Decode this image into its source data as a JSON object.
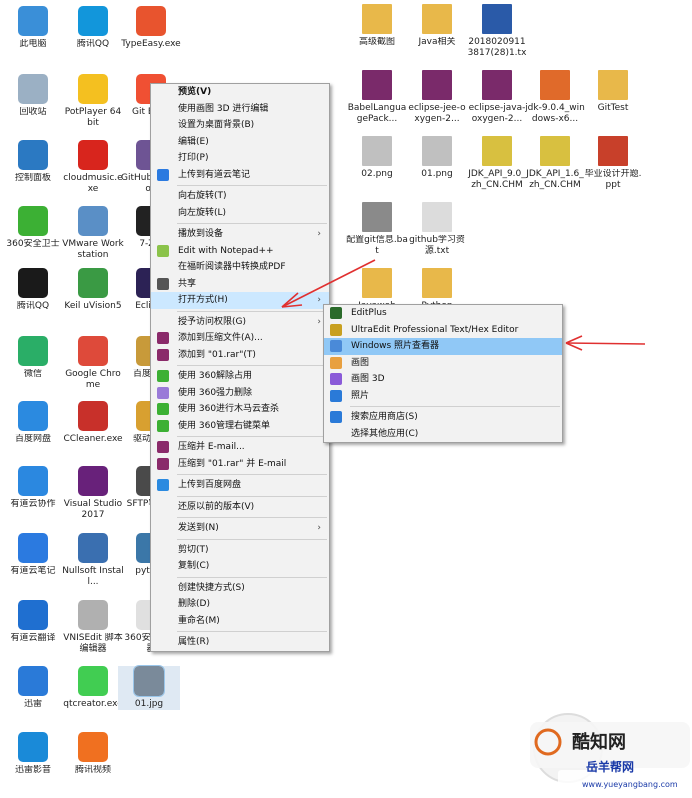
{
  "desktop_icons": [
    {
      "label": "此电脑",
      "color": "#3a8fd8"
    },
    {
      "label": "腾讯QQ",
      "color": "#1296db"
    },
    {
      "label": "TypeEasy.exe",
      "color": "#e8542e"
    },
    {
      "label": "回收站",
      "color": "#9bb0c4"
    },
    {
      "label": "PotPlayer 64 bit",
      "color": "#f4c020"
    },
    {
      "label": "Git Bash",
      "color": "#f05033"
    },
    {
      "label": "控制面板",
      "color": "#2b79c2"
    },
    {
      "label": "cloudmusic.exe",
      "color": "#d8251d"
    },
    {
      "label": "GitHub Desktop",
      "color": "#6e5494"
    },
    {
      "label": "360安全卫士",
      "color": "#3cb034"
    },
    {
      "label": "VMware Workstation",
      "color": "#5a8fc6"
    },
    {
      "label": "7-Zip",
      "color": "#222222"
    },
    {
      "label": "腾讯QQ",
      "color": "#1a1a1a"
    },
    {
      "label": "Keil uVision5",
      "color": "#3a9a44"
    },
    {
      "label": "Eclipse",
      "color": "#2c2255"
    },
    {
      "label": "微信",
      "color": "#2aae67"
    },
    {
      "label": "Google Chrome",
      "color": "#de4a3a"
    },
    {
      "label": "百度网盘",
      "color": "#c89a3a"
    },
    {
      "label": "百度网盘",
      "color": "#2b8ae0"
    },
    {
      "label": "CCleaner.exe",
      "color": "#c8302a"
    },
    {
      "label": "驱动精灵",
      "color": "#d8a030"
    },
    {
      "label": "有道云协作",
      "color": "#2b88e0"
    },
    {
      "label": "Visual Studio 2017",
      "color": "#68217a"
    },
    {
      "label": "SFTP客户端",
      "color": "#4a4a4a"
    },
    {
      "label": "有道云笔记",
      "color": "#2b7ae0"
    },
    {
      "label": "Nullsoft Install...",
      "color": "#3a6fb0"
    },
    {
      "label": "python",
      "color": "#3b77a8"
    },
    {
      "label": "有道云翻译",
      "color": "#1f6fd0"
    },
    {
      "label": "VNISEdit 脚本编辑器",
      "color": "#b0b0b0"
    },
    {
      "label": "360安全浏览器",
      "color": "#e0e0e0"
    },
    {
      "label": "迅雷",
      "color": "#2a7ad8"
    },
    {
      "label": "qtcreator.exe",
      "color": "#41cd52"
    },
    {
      "label": "01.jpg",
      "color": "#7a8a9a"
    },
    {
      "label": "迅雷影音",
      "color": "#1a8ad8"
    },
    {
      "label": "腾讯视频",
      "color": "#f07020"
    }
  ],
  "right_icons": [
    {
      "label": "高级截图",
      "color": "#e8b84a"
    },
    {
      "label": "Java相关",
      "color": "#e8b84a"
    },
    {
      "label": "20180209113817(28)1.txt",
      "color": "#2a5aa8"
    },
    {
      "label": "BabelLanguagePack...",
      "color": "#7a2a6a"
    },
    {
      "label": "eclipse-jee-oxygen-2...",
      "color": "#7a2a6a"
    },
    {
      "label": "eclipse-java-oxygen-2...",
      "color": "#7a2a6a"
    },
    {
      "label": "jdk-9.0.4_windows-x6...",
      "color": "#e06a2a"
    },
    {
      "label": "GitTest",
      "color": "#e8b84a"
    },
    {
      "label": "02.png",
      "color": "#c0c0c0"
    },
    {
      "label": "01.png",
      "color": "#c0c0c0"
    },
    {
      "label": "JDK_API_9.0_zh_CN.CHM",
      "color": "#d8c040"
    },
    {
      "label": "JDK_API_1.6_zh_CN.CHM",
      "color": "#d8c040"
    },
    {
      "label": "毕业设计开题.ppt",
      "color": "#c8402a"
    },
    {
      "label": "配置git信息.bat",
      "color": "#8a8a8a"
    },
    {
      "label": "github学习资源.txt",
      "color": "#dcdcdc"
    },
    {
      "label": "Javaweb",
      "color": "#e8b84a"
    },
    {
      "label": "Python",
      "color": "#e8b84a"
    }
  ],
  "context_menu": {
    "items": [
      {
        "label": "预览(V)",
        "bold": true
      },
      {
        "label": "使用画图 3D 进行编辑"
      },
      {
        "label": "设置为桌面背景(B)"
      },
      {
        "label": "编辑(E)"
      },
      {
        "label": "打印(P)"
      },
      {
        "label": "上传到有道云笔记",
        "icon": "youdao-note-icon",
        "color": "#2b7ae0"
      },
      {
        "sep": true
      },
      {
        "label": "向右旋转(T)"
      },
      {
        "label": "向左旋转(L)"
      },
      {
        "sep": true
      },
      {
        "label": "播放到设备",
        "arrow": true
      },
      {
        "label": "Edit with Notepad++",
        "icon": "notepad-plus-icon",
        "color": "#8bc34a"
      },
      {
        "label": "在福昕阅读器中转换成PDF"
      },
      {
        "label": "共享",
        "icon": "share-icon",
        "color": "#555555"
      },
      {
        "label": "打开方式(H)",
        "arrow": true,
        "highlight": true
      },
      {
        "sep": true
      },
      {
        "label": "授予访问权限(G)",
        "arrow": true
      },
      {
        "label": "添加到压缩文件(A)...",
        "icon": "winrar-icon",
        "color": "#8a2a6a"
      },
      {
        "label": "添加到 \"01.rar\"(T)",
        "icon": "winrar-icon",
        "color": "#8a2a6a"
      },
      {
        "sep": true
      },
      {
        "label": "使用 360解除占用",
        "icon": "360-unlock-icon",
        "color": "#3cb034"
      },
      {
        "label": "使用 360强力删除",
        "icon": "360-delete-icon",
        "color": "#9a7ad8"
      },
      {
        "label": "使用 360进行木马云查杀",
        "icon": "360-scan-icon",
        "color": "#3cb034"
      },
      {
        "label": "使用 360管理右键菜单",
        "icon": "360-menu-icon",
        "color": "#3cb034"
      },
      {
        "sep": true
      },
      {
        "label": "压缩并 E-mail...",
        "icon": "winrar-icon",
        "color": "#8a2a6a"
      },
      {
        "label": "压缩到 \"01.rar\" 并 E-mail",
        "icon": "winrar-icon",
        "color": "#8a2a6a"
      },
      {
        "sep": true
      },
      {
        "label": "上传到百度网盘",
        "icon": "baidu-pan-icon",
        "color": "#2b8ae0"
      },
      {
        "sep": true
      },
      {
        "label": "还原以前的版本(V)"
      },
      {
        "sep": true
      },
      {
        "label": "发送到(N)",
        "arrow": true
      },
      {
        "sep": true
      },
      {
        "label": "剪切(T)"
      },
      {
        "label": "复制(C)"
      },
      {
        "sep": true
      },
      {
        "label": "创建快捷方式(S)"
      },
      {
        "label": "删除(D)"
      },
      {
        "label": "重命名(M)"
      },
      {
        "sep": true
      },
      {
        "label": "属性(R)"
      }
    ]
  },
  "submenu": {
    "items": [
      {
        "label": "EditPlus",
        "icon": "editplus-icon",
        "color": "#2a6a2a"
      },
      {
        "label": "UltraEdit Professional Text/Hex Editor",
        "icon": "ultraedit-icon",
        "color": "#c8a020"
      },
      {
        "label": "Windows 照片查看器",
        "icon": "photo-viewer-icon",
        "color": "#4a8ad8",
        "highlight": true
      },
      {
        "label": "画图",
        "icon": "paint-icon",
        "color": "#e8a040"
      },
      {
        "label": "画图 3D",
        "icon": "paint-3d-icon",
        "color": "#8a5ad8"
      },
      {
        "label": "照片",
        "icon": "photos-icon",
        "color": "#2a7ad8"
      },
      {
        "sep": true
      },
      {
        "label": "搜索应用商店(S)",
        "icon": "store-icon",
        "color": "#2a7ad8"
      },
      {
        "label": "选择其他应用(C)"
      }
    ]
  },
  "watermark": {
    "brand": "酷知网",
    "site": "www.yueyangbang.com",
    "site_label": "岳羊帮网"
  }
}
